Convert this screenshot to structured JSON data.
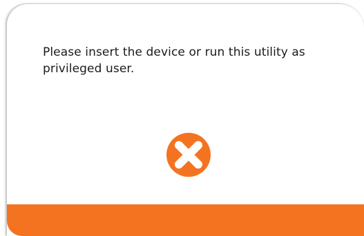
{
  "dialog": {
    "message": "Please insert the device or run this utility as privileged user.",
    "icon": "error-x-icon"
  },
  "colors": {
    "accent": "#f47320",
    "background": "#ffffff",
    "text": "#1a1a1a"
  }
}
